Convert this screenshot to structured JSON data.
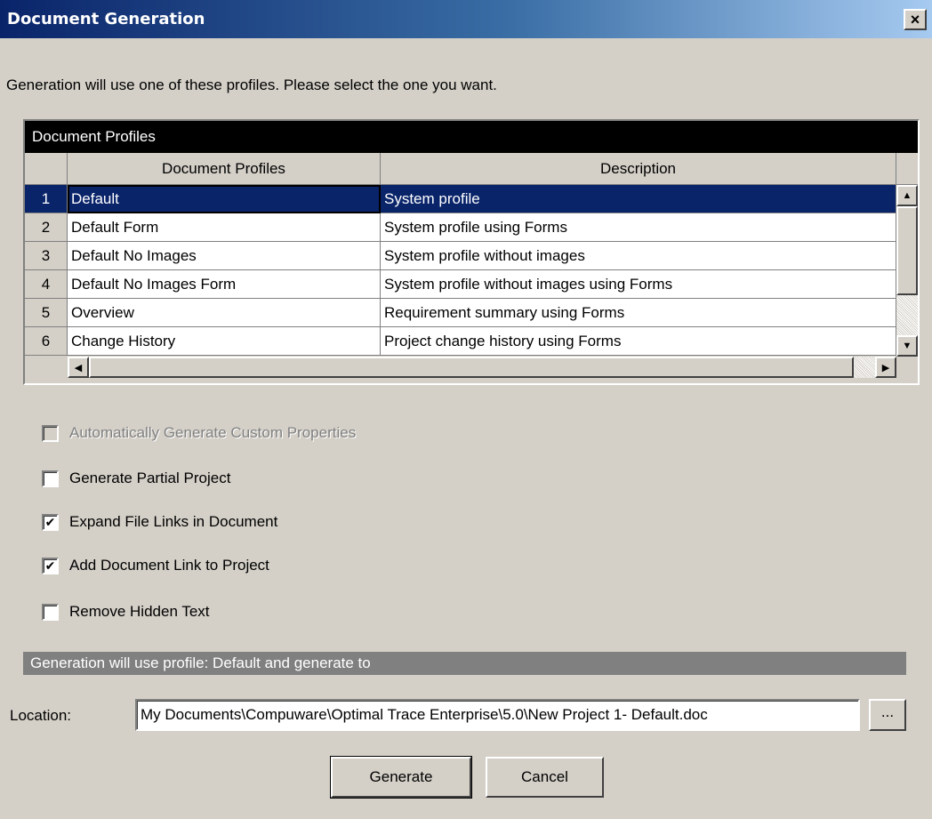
{
  "window": {
    "title": "Document Generation",
    "close_glyph": "×"
  },
  "intro_text": "Generation will use one of these profiles. Please select the one you want.",
  "grid": {
    "caption": "Document Profiles",
    "columns": [
      "Document Profiles",
      "Description"
    ],
    "rows": [
      {
        "num": "1",
        "profile": "Default",
        "description": "System profile",
        "selected": true
      },
      {
        "num": "2",
        "profile": "Default Form",
        "description": "System profile using Forms"
      },
      {
        "num": "3",
        "profile": "Default No Images",
        "description": "System profile without images"
      },
      {
        "num": "4",
        "profile": "Default No Images Form",
        "description": "System profile without images using Forms"
      },
      {
        "num": "5",
        "profile": "Overview",
        "description": "Requirement summary using Forms"
      },
      {
        "num": "6",
        "profile": "Change History",
        "description": "Project change history using Forms"
      }
    ]
  },
  "options": {
    "auto_custom_props": {
      "label": "Automatically Generate Custom Properties",
      "checked": false,
      "enabled": false
    },
    "partial_project": {
      "label": "Generate Partial Project",
      "checked": false
    },
    "expand_file_links": {
      "label": "Expand File Links in Document",
      "checked": true
    },
    "add_doc_link": {
      "label": "Add Document Link to Project",
      "checked": true
    },
    "remove_hidden": {
      "label": "Remove Hidden Text",
      "checked": false
    }
  },
  "status_text": "Generation will use profile: Default and generate to",
  "location": {
    "label": "Location:",
    "value": "My Documents\\Compuware\\Optimal Trace Enterprise\\5.0\\New Project 1- Default.doc",
    "browse_label": "..."
  },
  "buttons": {
    "generate": "Generate",
    "cancel": "Cancel"
  },
  "icons": {
    "checkmark": "✔",
    "scroll_up": "▲",
    "scroll_down": "▼",
    "scroll_left": "◀",
    "scroll_right": "▶"
  },
  "colors": {
    "selection": "#0a246a",
    "dialog_bg": "#d4d0c8"
  }
}
